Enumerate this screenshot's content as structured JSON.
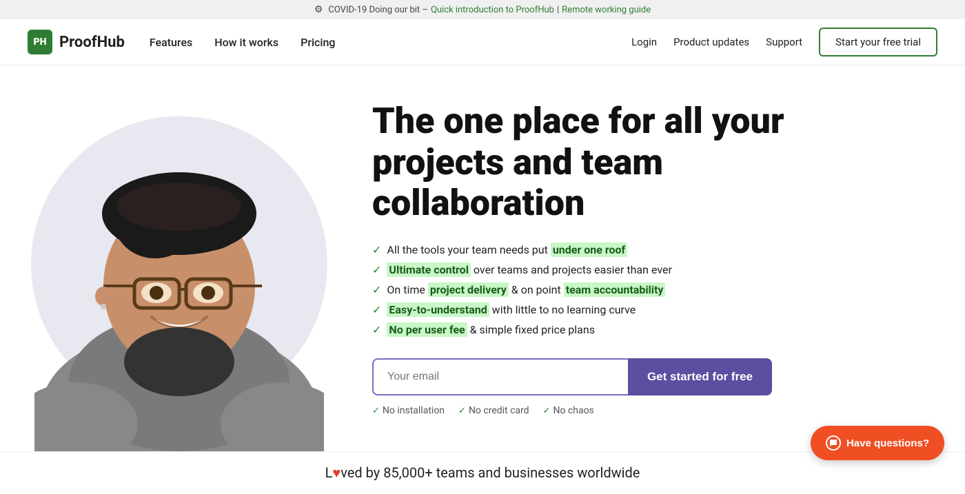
{
  "banner": {
    "gear": "⚙",
    "text_prefix": "COVID-19 Doing our bit –",
    "link1_text": "Quick introduction to ProofHub",
    "separator": "|",
    "link2_text": "Remote working guide"
  },
  "navbar": {
    "logo_text": "PH",
    "brand": "ProofHub",
    "nav_items": [
      {
        "label": "Features"
      },
      {
        "label": "How it works"
      },
      {
        "label": "Pricing"
      }
    ],
    "right_links": [
      {
        "label": "Login"
      },
      {
        "label": "Product updates"
      },
      {
        "label": "Support"
      }
    ],
    "cta_label": "Start your free trial"
  },
  "hero": {
    "title": "The one place for all your projects and team collaboration",
    "features": [
      {
        "text_before": "All the tools your team needs put",
        "highlight": "under one roof",
        "text_after": ""
      },
      {
        "text_before": "",
        "highlight": "Ultimate control",
        "text_after": " over teams and projects easier than ever"
      },
      {
        "text_before": "On time",
        "highlight": "project delivery",
        "text_mid": " & on point",
        "highlight2": "team accountability",
        "text_after": ""
      },
      {
        "text_before": "",
        "highlight": "Easy-to-understand",
        "text_after": " with little to no learning curve"
      },
      {
        "text_before": "",
        "highlight": "No per user fee",
        "text_after": " & simple fixed price plans"
      }
    ],
    "email_placeholder": "Your email",
    "cta_button": "Get started for free",
    "no_items": [
      "No installation",
      "No credit card",
      "No chaos"
    ]
  },
  "bottom": {
    "text_prefix": "L",
    "heart": "♥",
    "text_suffix": "ved by 85,000+ teams and businesses worldwide"
  },
  "chat": {
    "label": "Have questions?"
  }
}
